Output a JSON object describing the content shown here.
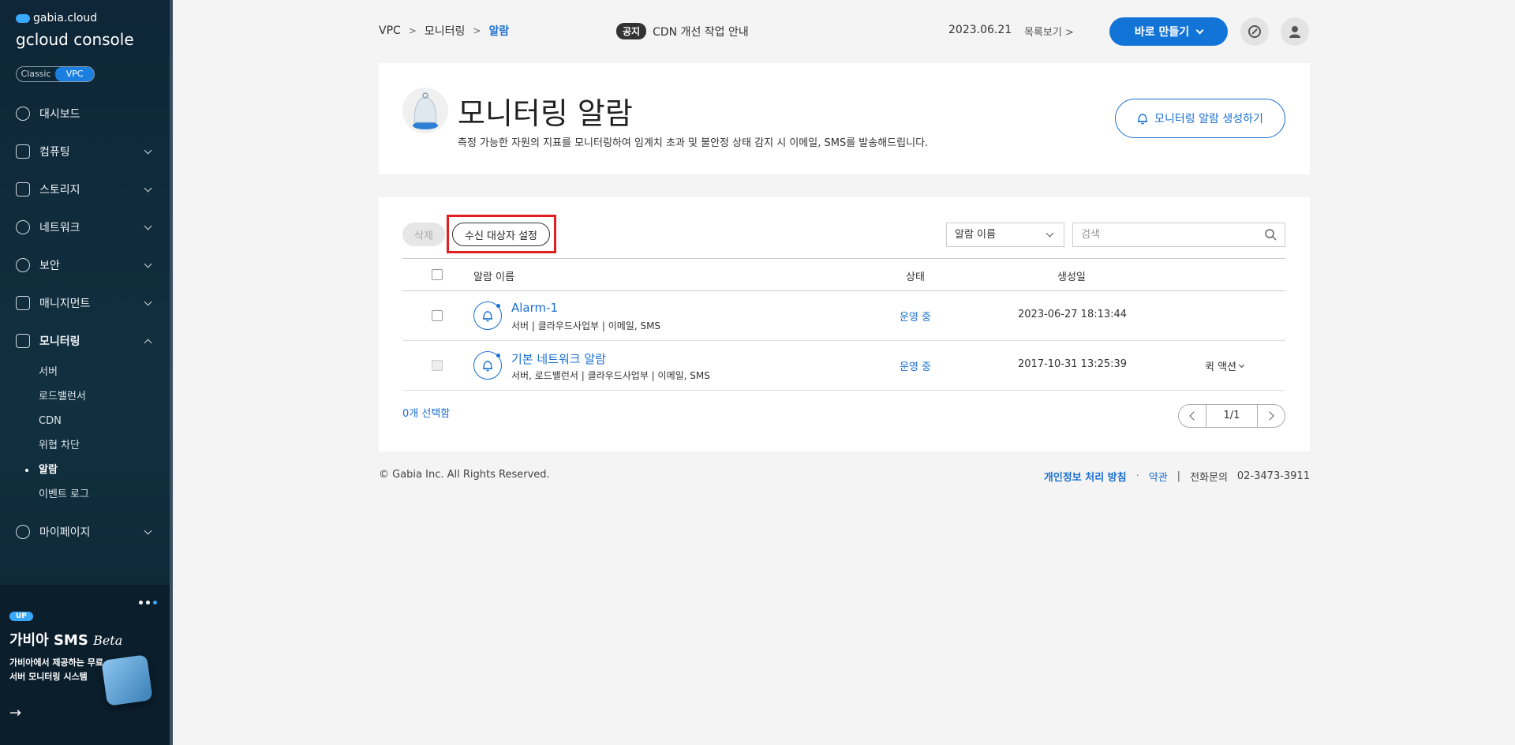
{
  "sidebar": {
    "brand_small": "gabia.cloud",
    "brand_main": "gcloud console",
    "mode_classic": "Classic",
    "mode_vpc": "VPC",
    "items": [
      {
        "label": "대시보드"
      },
      {
        "label": "컴퓨팅"
      },
      {
        "label": "스토리지"
      },
      {
        "label": "네트워크"
      },
      {
        "label": "보안"
      },
      {
        "label": "매니지먼트"
      },
      {
        "label": "모니터링"
      }
    ],
    "subitems": [
      {
        "label": "서버"
      },
      {
        "label": "로드밸런서"
      },
      {
        "label": "CDN"
      },
      {
        "label": "위협 차단"
      },
      {
        "label": "알람"
      },
      {
        "label": "이벤트 로그"
      }
    ],
    "mypage": "마이페이지",
    "promo": {
      "badge": "UP",
      "title": "가비아 SMS",
      "beta": "Beta",
      "desc": "가비아에서 제공하는 무료 서버 모니터링 시스템",
      "arrow": "→"
    }
  },
  "topbar": {
    "breadcrumb": [
      "VPC",
      "모니터링",
      "알람"
    ],
    "notice_badge": "공지",
    "notice_text": "CDN 개선 작업 안내",
    "notice_date": "2023.06.21",
    "notice_more": "목록보기 >",
    "create_label": "바로 만들기"
  },
  "header": {
    "title": "모니터링 알람",
    "description": "측정 가능한 자원의 지표를 모니터링하여 임계치 초과 및 불안정 상태 감지 시 이메일, SMS를 발송해드립니다.",
    "create_alarm_label": "모니터링 알람 생성하기"
  },
  "toolbar": {
    "delete_label": "삭제",
    "recipient_label": "수신 대상자 설정",
    "filter_selected": "알람 이름",
    "search_placeholder": "검색"
  },
  "table": {
    "headers": {
      "name": "알람 이름",
      "status": "상태",
      "created": "생성일"
    },
    "rows": [
      {
        "name": "Alarm-1",
        "meta": "서버  |  클라우드사업부  |  이메일, SMS",
        "status": "운영 중",
        "created": "2023-06-27 18:13:44",
        "action": ""
      },
      {
        "name": "기본 네트워크 알람",
        "meta": "서버, 로드밸런서  |  클라우드사업부  |  이메일, SMS",
        "status": "운영 중",
        "created": "2017-10-31 13:25:39",
        "action": "퀵 액션"
      }
    ],
    "selected_count": "0개 선택함",
    "page": "1/1"
  },
  "footer": {
    "copyright": "© Gabia Inc. All Rights Reserved.",
    "privacy": "개인정보 처리 방침",
    "terms": "약관",
    "phone_label": "전화문의",
    "phone": "02-3473-3911"
  },
  "colors": {
    "accent": "#1a6fd1",
    "primary_button": "#1374d8",
    "sidebar_bg": "#0f2a3d",
    "highlight": "#e02020"
  }
}
